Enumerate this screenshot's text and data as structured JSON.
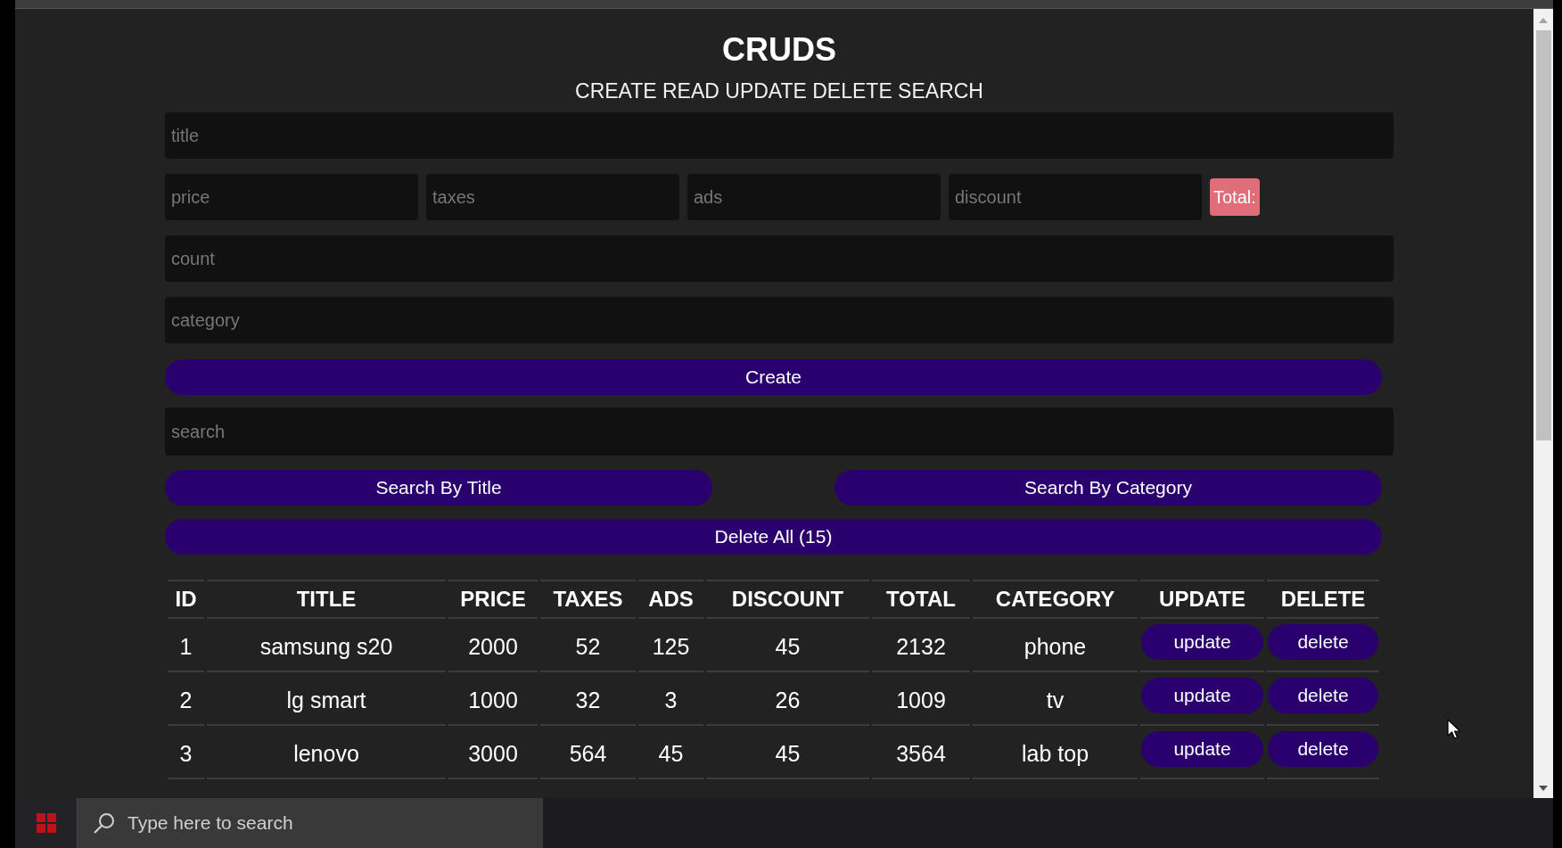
{
  "header": {
    "title": "CRUDS",
    "subtitle": "CREATE READ UPDATE DELETE SEARCH"
  },
  "form": {
    "title_field": {
      "placeholder": "title"
    },
    "amount_fields": [
      {
        "placeholder": "price"
      },
      {
        "placeholder": "taxes"
      },
      {
        "placeholder": "ads"
      },
      {
        "placeholder": "discount"
      }
    ],
    "total_label": "Total:",
    "count_field": {
      "placeholder": "count"
    },
    "category_field": {
      "placeholder": "category"
    },
    "create_button": "Create"
  },
  "search": {
    "field": {
      "placeholder": "search"
    },
    "buttons": [
      "Search By Title",
      "Search By Category"
    ]
  },
  "delete_all_button": "Delete All (15)",
  "table": {
    "columns": [
      "ID",
      "TITLE",
      "PRICE",
      "TAXES",
      "ADS",
      "DISCOUNT",
      "TOTAL",
      "CATEGORY",
      "UPDATE",
      "DELETE"
    ],
    "rows": [
      {
        "cells": [
          "1",
          "samsung s20",
          "2000",
          "52",
          "125",
          "45",
          "2132",
          "phone"
        ],
        "actions": [
          "update",
          "delete"
        ]
      },
      {
        "cells": [
          "2",
          "lg smart",
          "1000",
          "32",
          "3",
          "26",
          "1009",
          "tv"
        ],
        "actions": [
          "update",
          "delete"
        ]
      },
      {
        "cells": [
          "3",
          "lenovo",
          "3000",
          "564",
          "45",
          "45",
          "3564",
          "lab top"
        ],
        "actions": [
          "update",
          "delete"
        ]
      }
    ]
  },
  "taskbar": {
    "search_field": {
      "placeholder": "Type here to search"
    }
  }
}
